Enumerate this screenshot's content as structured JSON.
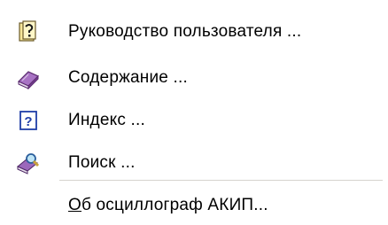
{
  "menu": {
    "items": [
      {
        "label": "Руководство пользователя ...",
        "icon": "guide-question-icon"
      },
      {
        "label": "Содержание ...",
        "icon": "book-contents-icon"
      },
      {
        "label": "Индекс ...",
        "icon": "help-index-icon"
      },
      {
        "label": "Поиск ...",
        "icon": "search-book-icon"
      }
    ],
    "about": {
      "mnemonic": "О",
      "rest": "б осциллограф АКИП..."
    }
  },
  "colors": {
    "separator": "#d6d3ce",
    "book_purple": "#8b4fa6",
    "help_blue": "#1f3ea8",
    "icon_yellow": "#e8c547"
  }
}
